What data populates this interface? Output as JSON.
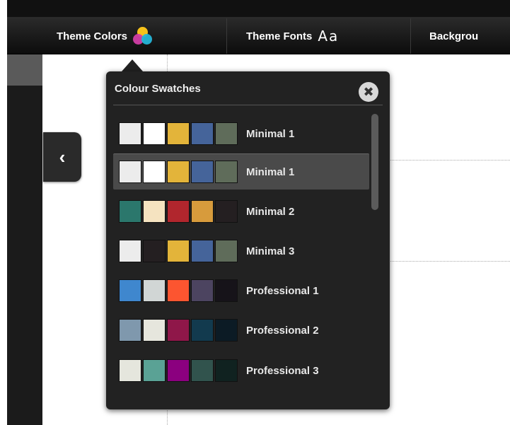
{
  "toolbar": {
    "theme_colors_label": "Theme Colors",
    "theme_fonts_label": "Theme Fonts",
    "theme_fonts_glyph": "Aa",
    "background_label": "Backgrou"
  },
  "popup": {
    "title": "Colour Swatches",
    "close_glyph": "✖",
    "rows": [
      {
        "label": "Minimal 1",
        "colors": [
          "#ececec",
          "#ffffff",
          "#e3b43a",
          "#45649a",
          "#5f6c5a"
        ]
      },
      {
        "label": "Minimal 1",
        "colors": [
          "#ececec",
          "#ffffff",
          "#e3b43a",
          "#45649a",
          "#5f6c5a"
        ]
      },
      {
        "label": "Minimal 2",
        "colors": [
          "#2b776c",
          "#f5e3c0",
          "#b1262d",
          "#d79b3c",
          "#241f21"
        ]
      },
      {
        "label": "Minimal 3",
        "colors": [
          "#ececec",
          "#241f21",
          "#e3b43a",
          "#45649a",
          "#5f6c5a"
        ]
      },
      {
        "label": "Professional 1",
        "colors": [
          "#3f87ce",
          "#d1d6d5",
          "#fc5530",
          "#4c4460",
          "#161319"
        ]
      },
      {
        "label": "Professional 2",
        "colors": [
          "#7f98ad",
          "#e6e6dd",
          "#8f1749",
          "#123a4e",
          "#0c1b25"
        ]
      },
      {
        "label": "Professional 3",
        "colors": [
          "#e5e6dd",
          "#5aa295",
          "#8b007f",
          "#31534d",
          "#102220"
        ]
      }
    ]
  },
  "rail": {
    "collapse_glyph": "‹"
  },
  "colors": {
    "accent_dark": "#222222",
    "selected_row": "#4a4a4a"
  }
}
